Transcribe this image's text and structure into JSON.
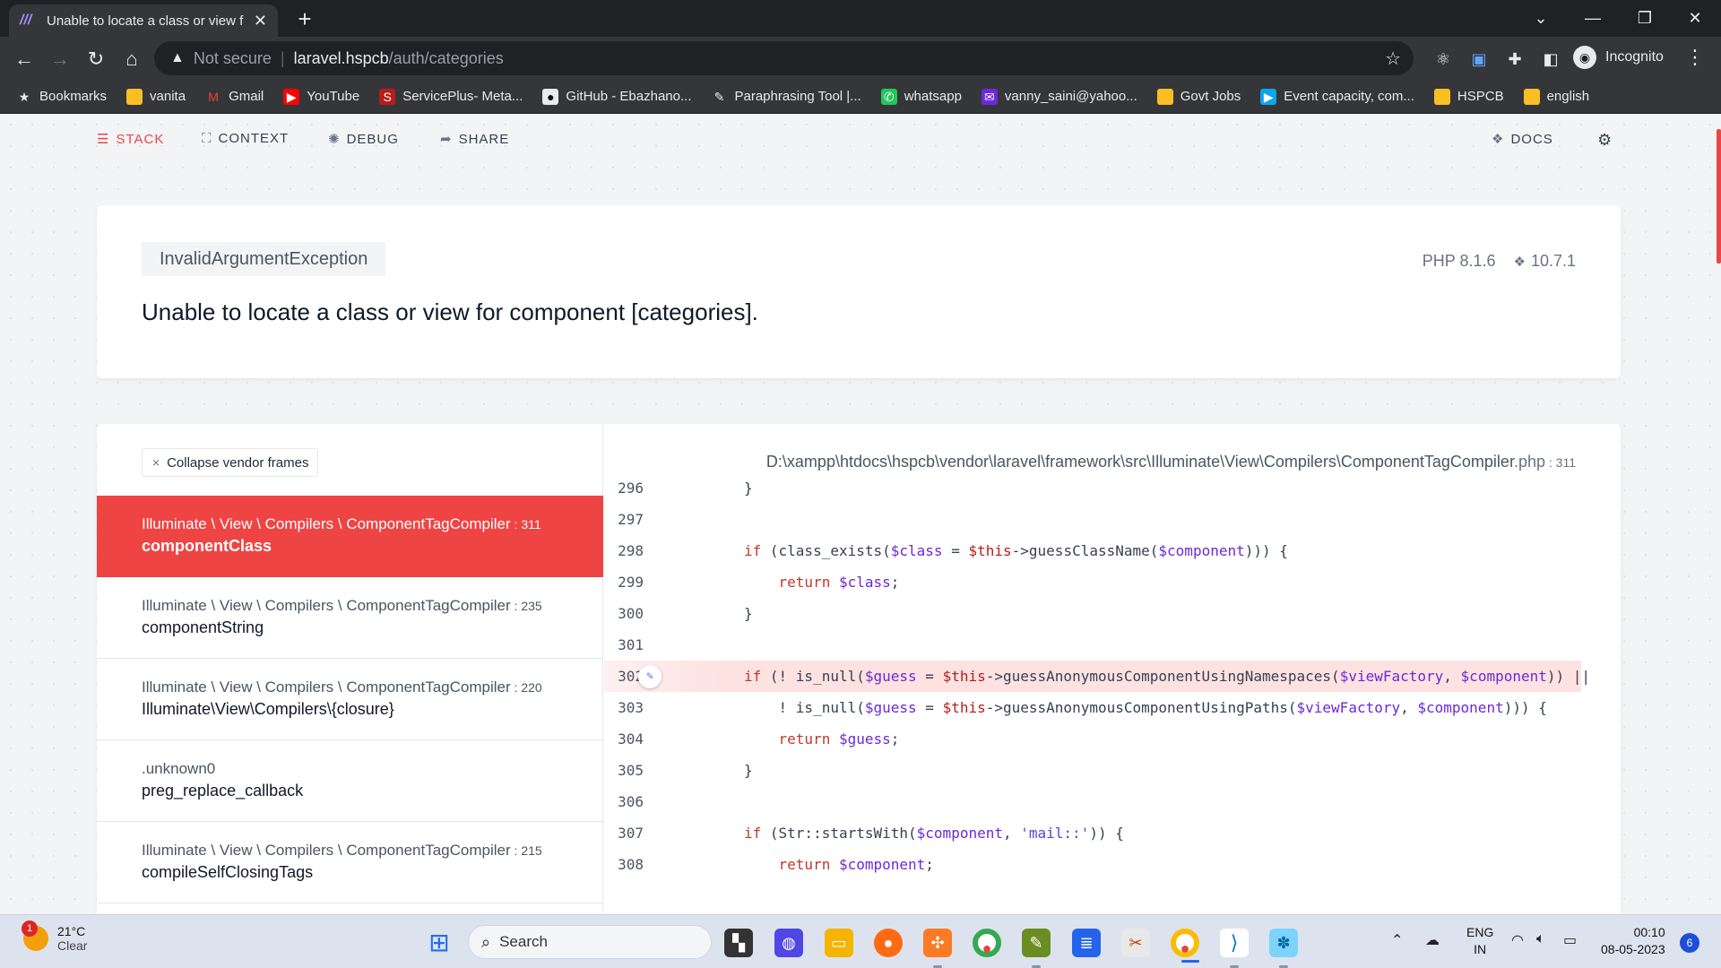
{
  "browser": {
    "tab_title": "Unable to locate a class or view f",
    "new_tab": "+",
    "url_warning": "Not secure",
    "url_host": "laravel.hspcb",
    "url_path": "/auth/categories",
    "profile": "Incognito",
    "bookmarks": [
      {
        "label": "Bookmarks",
        "icon": "star-icon"
      },
      {
        "label": "vanita",
        "icon": "folder-icon"
      },
      {
        "label": "Gmail",
        "icon": "gmail-icon"
      },
      {
        "label": "YouTube",
        "icon": "youtube-icon"
      },
      {
        "label": "ServicePlus- Meta...",
        "icon": "serviceplus-icon"
      },
      {
        "label": "GitHub - Ebazhano...",
        "icon": "github-icon"
      },
      {
        "label": "Paraphrasing Tool |...",
        "icon": "quill-icon"
      },
      {
        "label": "whatsapp",
        "icon": "whatsapp-icon"
      },
      {
        "label": "vanny_saini@yahoo...",
        "icon": "yahoo-mail-icon"
      },
      {
        "label": "Govt Jobs",
        "icon": "folder-icon"
      },
      {
        "label": "Event capacity, com...",
        "icon": "event-icon"
      },
      {
        "label": "HSPCB",
        "icon": "folder-icon"
      },
      {
        "label": "english",
        "icon": "folder-icon"
      }
    ]
  },
  "ignition": {
    "nav": {
      "stack": "STACK",
      "context": "CONTEXT",
      "debug": "DEBUG",
      "share": "SHARE",
      "docs": "DOCS"
    },
    "exception_class": "InvalidArgumentException",
    "message": "Unable to locate a class or view for component [categories].",
    "php_version": "PHP 8.1.6",
    "laravel_version": "10.7.1",
    "collapse_label": "Collapse vendor frames",
    "frames": [
      {
        "cls": "Illuminate \\ View \\ Compilers \\ ComponentTagCompiler",
        "line": "311",
        "fn": "componentClass",
        "active": true
      },
      {
        "cls": "Illuminate \\ View \\ Compilers \\ ComponentTagCompiler",
        "line": "235",
        "fn": "componentString",
        "active": false
      },
      {
        "cls": "Illuminate \\ View \\ Compilers \\ ComponentTagCompiler",
        "line": "220",
        "fn": "Illuminate\\View\\Compilers\\{closure}",
        "active": false
      },
      {
        "cls": ".unknown0",
        "line": "",
        "fn": "preg_replace_callback",
        "active": false
      },
      {
        "cls": "Illuminate \\ View \\ Compilers \\ ComponentTagCompiler",
        "line": "215",
        "fn": "compileSelfClosingTags",
        "active": false
      }
    ],
    "file_path": "D:\\xampp\\htdocs\\hspcb\\vendor\\laravel\\framework\\src\\Illuminate\\View\\Compilers\\ComponentTagCompiler",
    "file_ext": ".php",
    "file_line": "311",
    "highlight_line": "302",
    "code": [
      {
        "n": "296",
        "t": "}"
      },
      {
        "n": "297",
        "t": ""
      },
      {
        "n": "298",
        "t": "if (class_exists($class = $this->guessClassName($component))) {"
      },
      {
        "n": "299",
        "t": "    return $class;"
      },
      {
        "n": "300",
        "t": "}"
      },
      {
        "n": "301",
        "t": ""
      },
      {
        "n": "302",
        "t": "if (! is_null($guess = $this->guessAnonymousComponentUsingNamespaces($viewFactory, $component)) ||"
      },
      {
        "n": "303",
        "t": "    ! is_null($guess = $this->guessAnonymousComponentUsingPaths($viewFactory, $component))) {"
      },
      {
        "n": "304",
        "t": "    return $guess;"
      },
      {
        "n": "305",
        "t": "}"
      },
      {
        "n": "306",
        "t": ""
      },
      {
        "n": "307",
        "t": "if (Str::startsWith($component, 'mail::')) {"
      },
      {
        "n": "308",
        "t": "    return $component;"
      }
    ]
  },
  "taskbar": {
    "weather_badge": "1",
    "temperature": "21°C",
    "condition": "Clear",
    "search_placeholder": "Search",
    "lang": "ENG",
    "region": "IN",
    "time": "00:10",
    "date": "08-05-2023",
    "notifications": "6"
  },
  "colors": {
    "accent": "#ef4444",
    "keyword": "#c0392b",
    "variable": "#6d28d9",
    "string": "#4f46e5"
  }
}
